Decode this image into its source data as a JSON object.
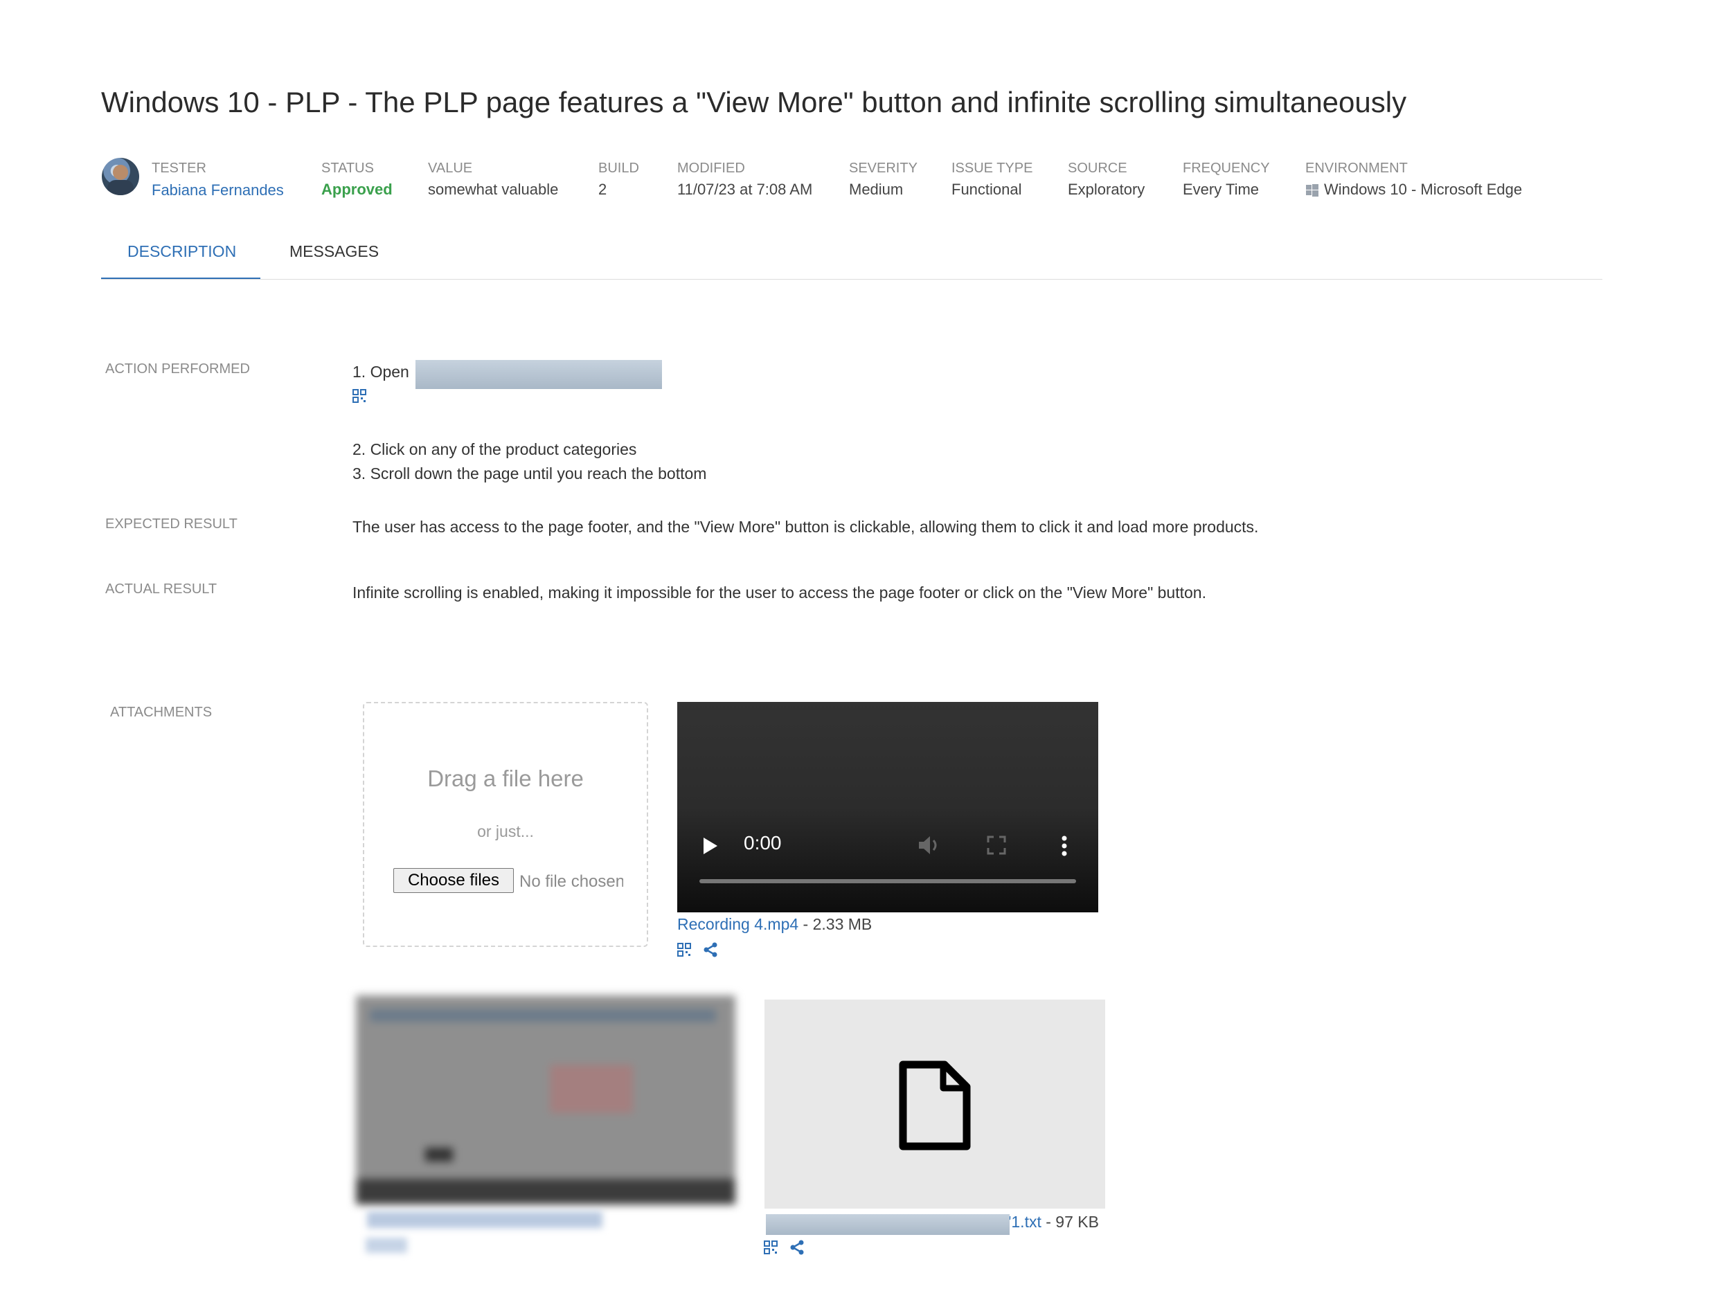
{
  "title": "Windows 10 - PLP - The PLP page features a \"View More\" button and infinite scrolling simultaneously",
  "meta": {
    "tester_label": "TESTER",
    "tester_value": "Fabiana Fernandes",
    "status_label": "STATUS",
    "status_value": "Approved",
    "value_label": "VALUE",
    "value_value": "somewhat valuable",
    "build_label": "BUILD",
    "build_value": "2",
    "modified_label": "MODIFIED",
    "modified_value": "11/07/23 at 7:08 AM",
    "severity_label": "SEVERITY",
    "severity_value": "Medium",
    "issue_type_label": "ISSUE TYPE",
    "issue_type_value": "Functional",
    "source_label": "SOURCE",
    "source_value": "Exploratory",
    "frequency_label": "FREQUENCY",
    "frequency_value": "Every Time",
    "environment_label": "ENVIRONMENT",
    "environment_value": "Windows 10 - Microsoft Edge"
  },
  "tabs": {
    "description": "DESCRIPTION",
    "messages": "MESSAGES"
  },
  "action": {
    "label": "ACTION PERFORMED",
    "step1": "1. Open",
    "step2": "2. Click on any of the product categories",
    "step3": "3. Scroll down the page until you reach the bottom"
  },
  "expected": {
    "label": "EXPECTED RESULT",
    "text": "The user has access to the page footer, and the \"View More\" button is clickable, allowing them to click it and load more products."
  },
  "actual": {
    "label": "ACTUAL RESULT",
    "text": "Infinite scrolling is enabled, making it impossible for the user to access the page footer or click on the \"View More\" button."
  },
  "attachments": {
    "label": "ATTACHMENTS",
    "drop_title": "Drag a file here",
    "drop_or": "or just...",
    "choose_button": "Choose files",
    "no_file": "No file chosen",
    "video_time": "0:00",
    "video_name": "Recording 4.mp4",
    "video_size": " - 2.33 MB",
    "file_name_suffix": "'1.txt",
    "file_size": " - 97 KB"
  },
  "colors": {
    "accent": "#2e6fb5",
    "approved": "#3aa04c"
  }
}
